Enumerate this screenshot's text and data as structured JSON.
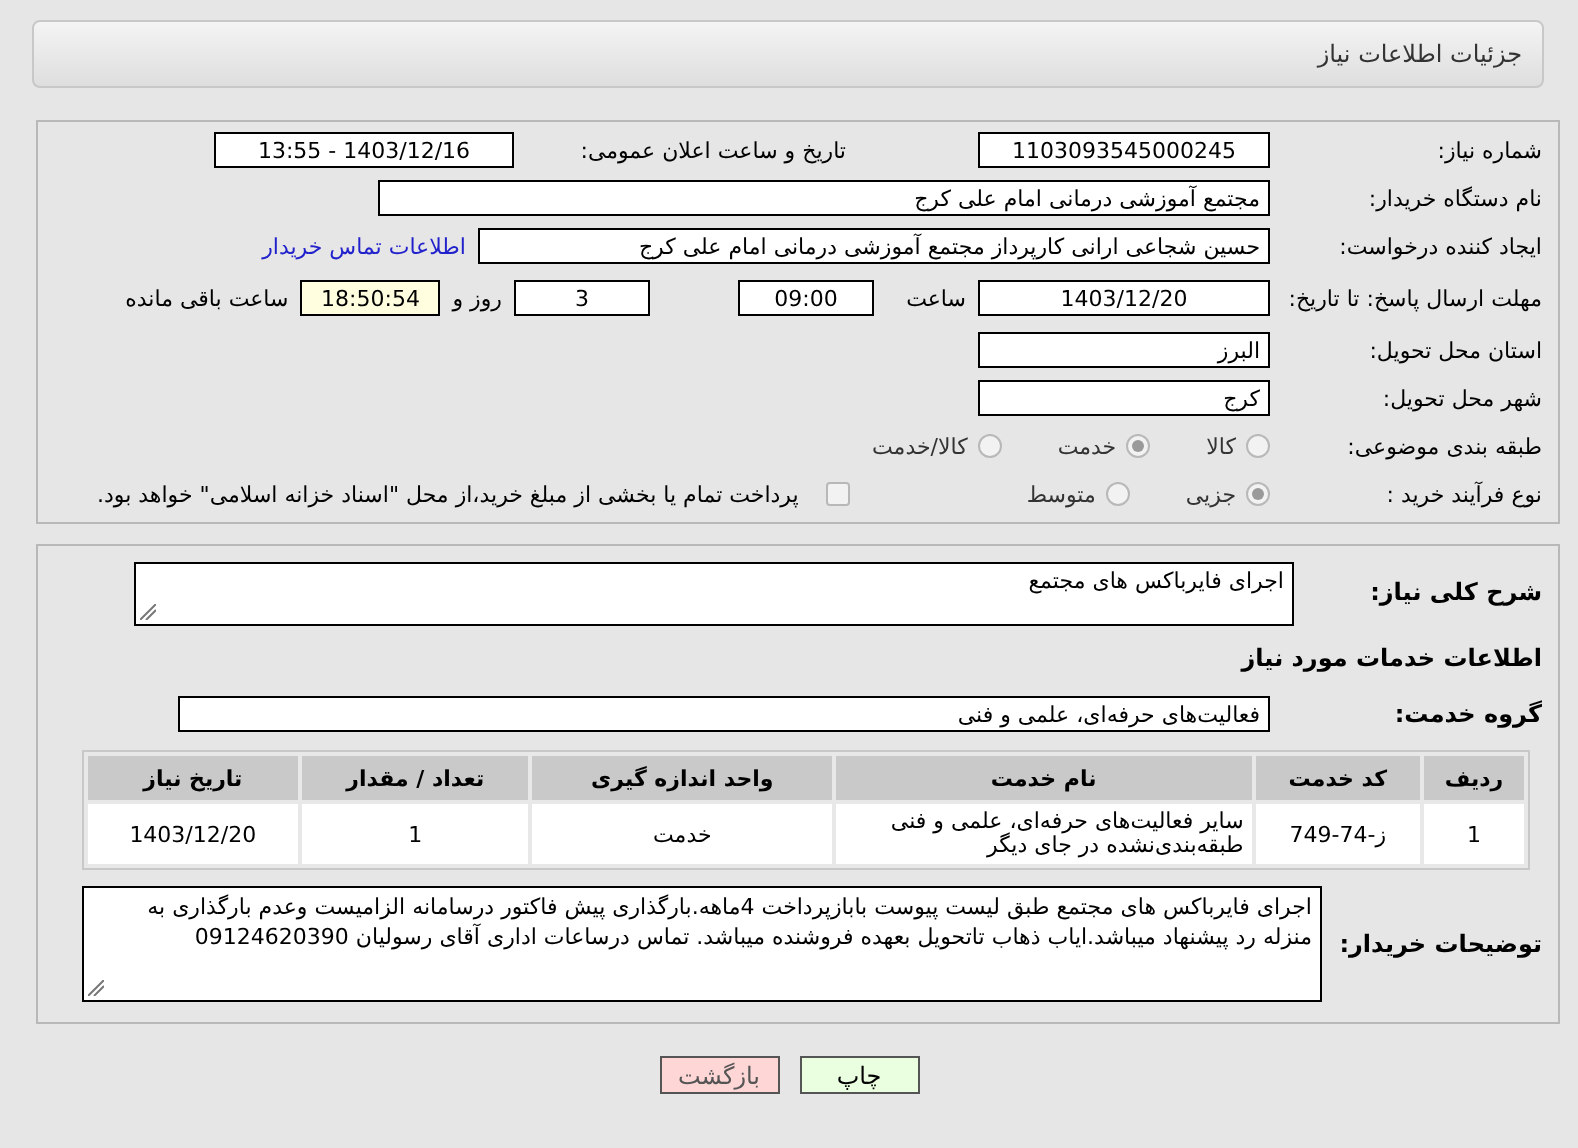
{
  "header": {
    "title": "جزئیات اطلاعات نیاز"
  },
  "details": {
    "need_number": {
      "label": "شماره نیاز:",
      "value": "1103093545000245"
    },
    "announce": {
      "label": "تاریخ و ساعت اعلان عمومی:",
      "value": "1403/12/16 - 13:55"
    },
    "buyer": {
      "label": "نام دستگاه خریدار:",
      "value": "مجتمع آموزشی درمانی امام علی کرج"
    },
    "creator": {
      "label": "ایجاد کننده درخواست:",
      "value": "حسین شجاعی ارانی کارپرداز مجتمع آموزشی درمانی امام علی کرج",
      "link": "اطلاعات تماس خریدار"
    },
    "deadline": {
      "label": "مهلت ارسال پاسخ: تا تاریخ:",
      "date": "1403/12/20",
      "time_label": "ساعت",
      "time": "09:00",
      "days": "3",
      "days_label": "روز و",
      "remaining": "18:50:54",
      "remaining_label": "ساعت باقی مانده"
    },
    "province": {
      "label": "استان محل تحویل:",
      "value": "البرز"
    },
    "city": {
      "label": "شهر محل تحویل:",
      "value": "کرج"
    },
    "category": {
      "label": "طبقه بندی موضوعی:",
      "options": [
        {
          "label": "کالا",
          "selected": false
        },
        {
          "label": "خدمت",
          "selected": true
        },
        {
          "label": "کالا/خدمت",
          "selected": false
        }
      ]
    },
    "process": {
      "label": "نوع فرآیند خرید :",
      "options": [
        {
          "label": "جزیی",
          "selected": true
        },
        {
          "label": "متوسط",
          "selected": false
        }
      ],
      "payment": {
        "checked": false,
        "label": "پرداخت تمام یا بخشی از مبلغ خرید،از محل \"اسناد خزانه اسلامی\" خواهد بود."
      }
    }
  },
  "description": {
    "label": "شرح کلی نیاز:",
    "value": "اجرای فایرباکس های مجتمع"
  },
  "services": {
    "title": "اطلاعات خدمات مورد نیاز",
    "group_label": "گروه خدمت:",
    "group": "فعالیت‌های حرفه‌ای، علمی و فنی",
    "table": {
      "columns": [
        "ردیف",
        "کد خدمت",
        "نام خدمت",
        "واحد اندازه گیری",
        "تعداد / مقدار",
        "تاریخ نیاز"
      ],
      "rows": [
        [
          "1",
          "ز-74-749",
          "سایر فعالیت‌های حرفه‌ای، علمی و فنی طبقه‌بندی‌نشده در جای دیگر",
          "خدمت",
          "1",
          "1403/12/20"
        ]
      ]
    }
  },
  "notes": {
    "label": "توضیحات خریدار:",
    "value": "اجرای فایرباکس های مجتمع طبق لیست پیوست بابازپرداخت 4ماهه.بارگذاری پیش فاکتور درسامانه الزامیست وعدم بارگذاری به منزله رد پیشنهاد میباشد.ایاب ذهاب تاتحویل بعهده فروشنده میباشد. تماس درساعات اداری آقای رسولیان 09124620390"
  },
  "buttons": [
    {
      "label": "چاپ",
      "kind": "print"
    },
    {
      "label": "بازگشت",
      "kind": "back"
    }
  ]
}
